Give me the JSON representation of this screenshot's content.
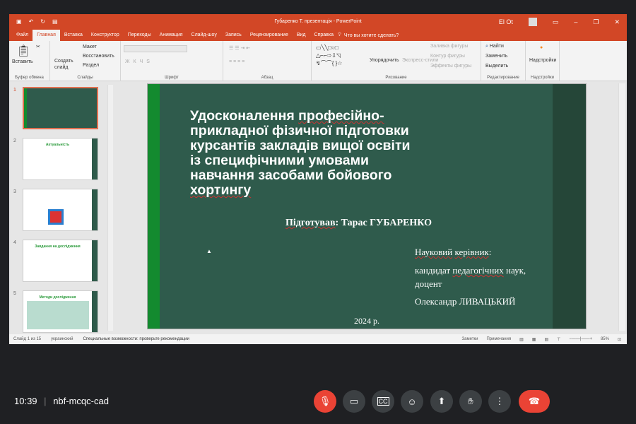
{
  "window": {
    "title": "Губаренко Т. презентація  -  PowerPoint",
    "user": "El Ot"
  },
  "tabs": [
    "Файл",
    "Главная",
    "Вставка",
    "Конструктор",
    "Переходы",
    "Анимация",
    "Слайд-шоу",
    "Запись",
    "Рецензирование",
    "Вид",
    "Справка"
  ],
  "tell_me": "Что вы хотите сделать?",
  "ribbon": {
    "clipboard": {
      "paste": "Вставить",
      "label": "Буфер обмена"
    },
    "slides": {
      "new_slide": "Создать слайд",
      "layout": "Макет",
      "reset": "Восстановить",
      "section": "Раздел",
      "label": "Слайды"
    },
    "font": {
      "label": "Шрифт"
    },
    "paragraph": {
      "label": "Абзац"
    },
    "drawing": {
      "arrange": "Упорядочить",
      "quick_styles": "Экспресс-стили",
      "fill": "Заливка фигуры",
      "outline": "Контур фигуры",
      "effects": "Эффекты фигуры",
      "label": "Рисование"
    },
    "editing": {
      "find": "Найти",
      "replace": "Заменить",
      "select": "Выделить",
      "label": "Редактирование"
    },
    "addins": {
      "button": "Надстройки",
      "label": "Надстройки"
    }
  },
  "thumbnails": [
    {
      "num": "1",
      "title": ""
    },
    {
      "num": "2",
      "title": "Актуальність"
    },
    {
      "num": "3",
      "title": ""
    },
    {
      "num": "4",
      "title": "Завдання на дослідження"
    },
    {
      "num": "5",
      "title": "Методи дослідження"
    }
  ],
  "slide": {
    "title": [
      "Удосконалення ",
      "професійно-",
      "прикладної фізичної підготовки",
      "курсантів закладів вищої освіти",
      "із специфічними умовами",
      "навчання засобами бойового",
      "хортингу"
    ],
    "prepared_label": "Підготував",
    "prepared_name": ": Тарас ГУБАРЕНКО",
    "advisor_a": "Науковий",
    "advisor_b": " керівник",
    "advisor_colon": ":",
    "degree_a": "кандидат ",
    "degree_b": "педагогічних",
    "degree_c": " наук,",
    "position": "доцент",
    "advisor_name": "Олександр ЛИВАЦЬКИЙ",
    "year": "2024 р."
  },
  "status": {
    "slide": "Слайд 1 из 15",
    "lang": "украинский",
    "accessibility": "Специальные возможности: проверьте рекомендации",
    "notes": "Заметки",
    "comments": "Примечания",
    "zoom": "85%"
  },
  "meet": {
    "time": "10:39",
    "code": "nbf-mcqc-cad"
  }
}
